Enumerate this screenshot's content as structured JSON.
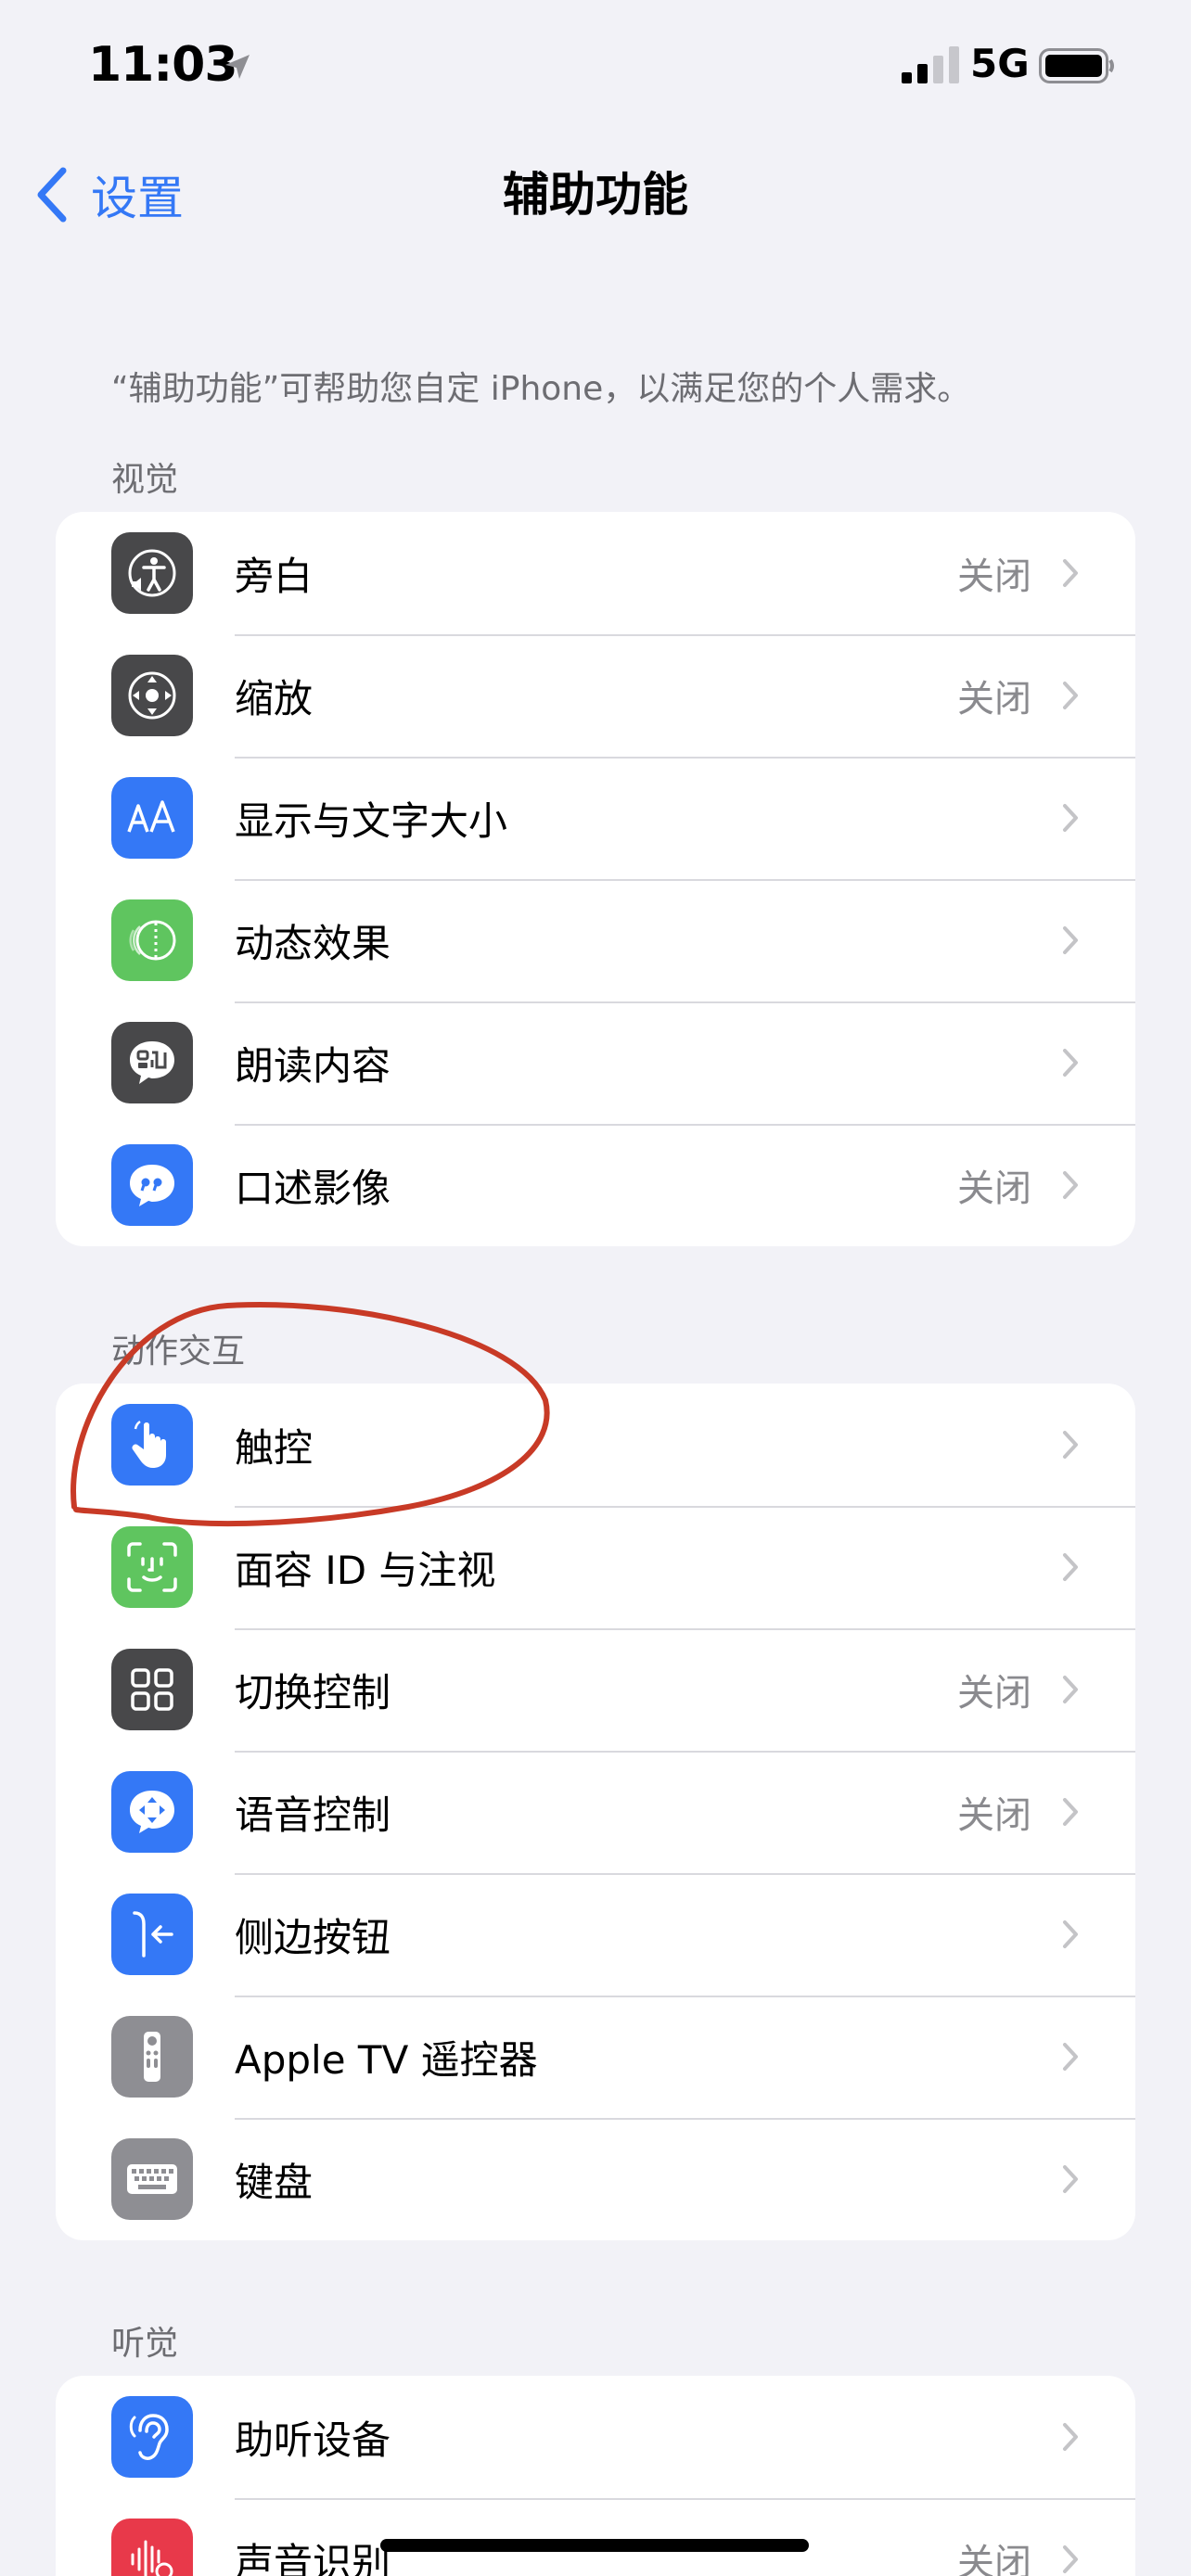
{
  "status_bar": {
    "time": "11:03",
    "network": "5G"
  },
  "nav": {
    "back_label": "设置",
    "title": "辅助功能"
  },
  "intro": "“辅助功能”可帮助您自定 iPhone，以满足您的个人需求。",
  "sections": [
    {
      "title": "视觉",
      "items": [
        {
          "label": "旁白",
          "value": "关闭",
          "icon": "voiceover-icon",
          "color": "#48484a"
        },
        {
          "label": "缩放",
          "value": "关闭",
          "icon": "zoom-icon",
          "color": "#48484a"
        },
        {
          "label": "显示与文字大小",
          "value": "",
          "icon": "text-size-icon",
          "color": "#3478f6"
        },
        {
          "label": "动态效果",
          "value": "",
          "icon": "motion-icon",
          "color": "#5fc55f"
        },
        {
          "label": "朗读内容",
          "value": "",
          "icon": "spoken-content-icon",
          "color": "#48484a"
        },
        {
          "label": "口述影像",
          "value": "关闭",
          "icon": "audio-descriptions-icon",
          "color": "#3478f6"
        }
      ]
    },
    {
      "title": "动作交互",
      "items": [
        {
          "label": "触控",
          "value": "",
          "icon": "touch-hand-icon",
          "color": "#3478f6"
        },
        {
          "label": "面容 ID 与注视",
          "value": "",
          "icon": "face-id-icon",
          "color": "#5fc55f"
        },
        {
          "label": "切换控制",
          "value": "关闭",
          "icon": "switch-control-icon",
          "color": "#48484a"
        },
        {
          "label": "语音控制",
          "value": "关闭",
          "icon": "voice-control-icon",
          "color": "#3478f6"
        },
        {
          "label": "侧边按钮",
          "value": "",
          "icon": "side-button-icon",
          "color": "#3478f6"
        },
        {
          "label": "Apple TV 遥控器",
          "value": "",
          "icon": "apple-tv-remote-icon",
          "color": "#8e8e93"
        },
        {
          "label": "键盘",
          "value": "",
          "icon": "keyboard-icon",
          "color": "#8e8e93"
        }
      ]
    },
    {
      "title": "听觉",
      "items": [
        {
          "label": "助听设备",
          "value": "",
          "icon": "hearing-icon",
          "color": "#3478f6"
        },
        {
          "label": "声音识别",
          "value": "关闭",
          "icon": "sound-recognition-icon",
          "color": "#e8394a"
        }
      ]
    }
  ]
}
